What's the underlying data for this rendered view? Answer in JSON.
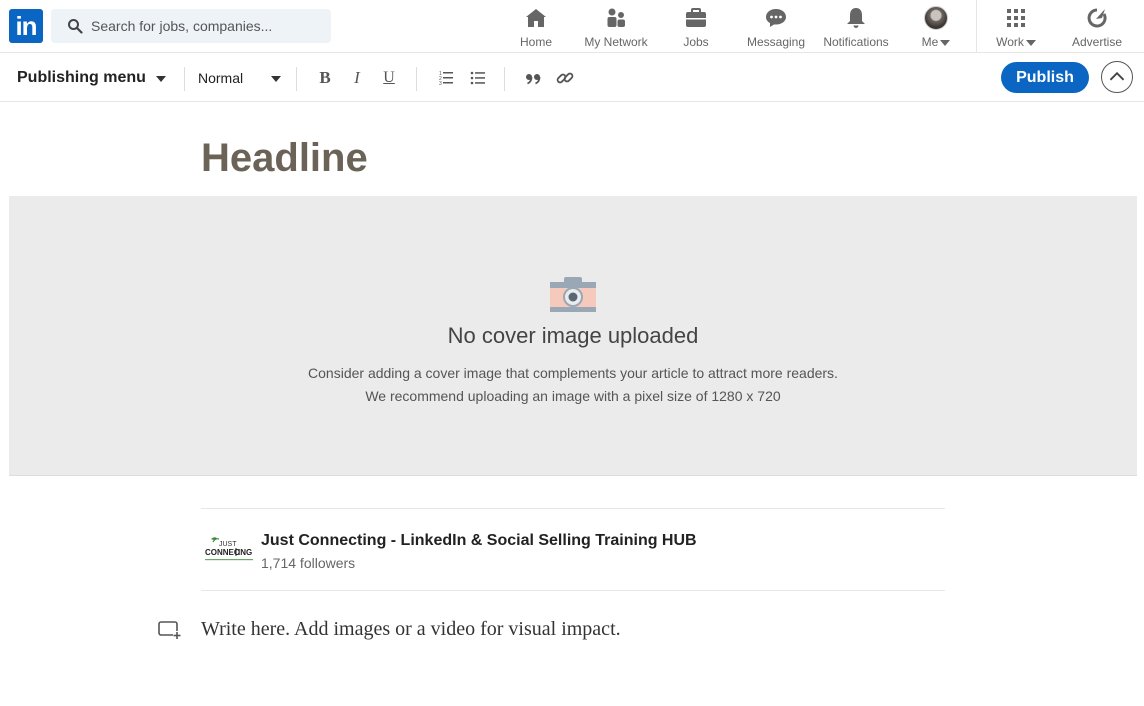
{
  "nav": {
    "logo": "in",
    "search_placeholder": "Search for jobs, companies...",
    "items": [
      {
        "label": "Home",
        "icon": "home-icon"
      },
      {
        "label": "My Network",
        "icon": "network-icon"
      },
      {
        "label": "Jobs",
        "icon": "briefcase-icon"
      },
      {
        "label": "Messaging",
        "icon": "chat-icon"
      },
      {
        "label": "Notifications",
        "icon": "bell-icon"
      },
      {
        "label": "Me",
        "icon": "avatar"
      },
      {
        "label": "Work",
        "icon": "grid-icon"
      },
      {
        "label": "Advertise",
        "icon": "compass-icon"
      }
    ]
  },
  "toolbar": {
    "publishing_menu": "Publishing menu",
    "text_style": "Normal",
    "bold": "B",
    "italic": "I",
    "underline": "U",
    "publish_label": "Publish"
  },
  "editor": {
    "headline": "Headline",
    "cover_title": "No cover image uploaded",
    "cover_hint_1": "Consider adding a cover image that complements your article to attract more readers.",
    "cover_hint_2": "We recommend uploading an image with a pixel size of 1280 x 720",
    "author_name": "Just Connecting - LinkedIn & Social Selling Training HUB",
    "author_followers": "1,714 followers",
    "author_logo_text": "JUST CONNECTING",
    "body_placeholder": "Write here. Add images or a video for visual impact."
  },
  "colors": {
    "brand": "#0a66c2",
    "cover_bg": "#ebebeb",
    "headline": "#6b6357"
  }
}
